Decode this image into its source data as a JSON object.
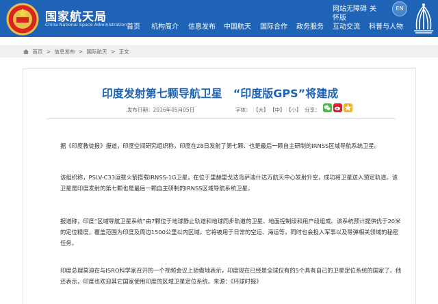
{
  "header": {
    "site_name_cn": "国家航天局",
    "site_name_en": "China National Space Administration",
    "util": {
      "accessible": "网站无障碍",
      "care": "怀版",
      "close": "关",
      "lang": "EN"
    },
    "nav": [
      "首页",
      "机构简介",
      "信息发布",
      "中国航天",
      "国际合作",
      "政务服务",
      "互动交流",
      "科普与人物"
    ]
  },
  "breadcrumb": [
    "首页",
    ">",
    "信息发布",
    ">",
    "国际航天",
    ">",
    "正文"
  ],
  "article": {
    "title": "印度发射第七颗导航卫星　“印度版GPS”将建成",
    "publish_label": "发布日期：2016年05月05日",
    "font_label": "字体：",
    "font_sizes": [
      "【大】",
      "【中】",
      "【小】"
    ],
    "share_label": "分享：",
    "paragraphs": [
      "据《印度教徒报》报道，印度空间研究组织称，印度在28日发射了第七颗、也是最后一颗自主研制的IRNSS区域导航系统卫星。",
      "该组织称，PSLV-C33运载火箭搭载IRNSS-1G卫星，在位于里赫里戈达岛萨迪什达万航天中心发射升空，成功将卫星送入预定轨道。该卫星是印度发射的第七颗也是最后一颗自主研制的IRNSS区域导航系统卫星。",
      "报道称，印度“区域导航卫星系统”由7颗位于地球静止轨道和地球同步轨道的卫星、地面控制段和用户段组成。该系统预计提供优于20米的定位精度，覆盖范围为印度及周边1500公里以内区域。它将被用于日常的空运、海运等，同时也会投入军事以及导弹相关领域的秘密任务。",
      "印度总理莫迪在与ISRO科学家召开的一个视频会议上骄傲地表示，印度现在已经是全球仅有的5个具有自己的卫星定位系统的国家了。他还表示，印度也欢迎其它国家使用印度的区域卫星定位系统。来源：《环球时报》"
    ]
  },
  "colors": {
    "brand_blue": "#1e63b5",
    "wechat": "#4cb846",
    "weibo": "#e6162d",
    "qzone": "#f6b120"
  }
}
